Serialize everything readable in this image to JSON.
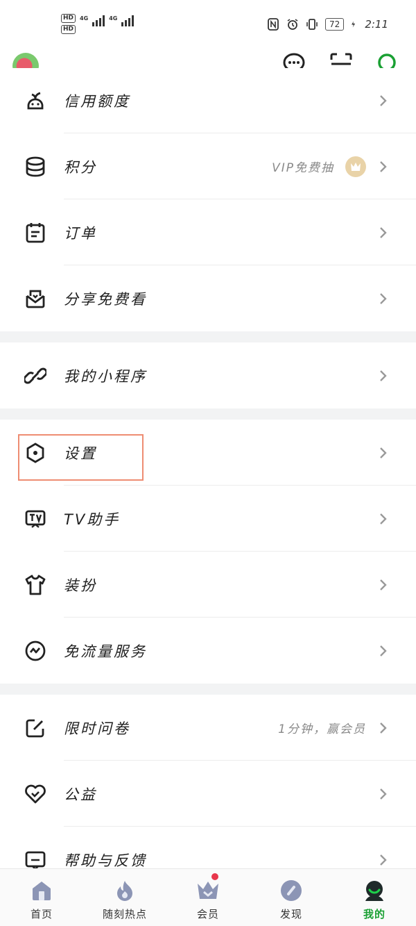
{
  "status_bar": {
    "hd1": "HD",
    "hd2": "HD",
    "net1": "4G",
    "net2": "4G",
    "battery": "72",
    "time": "2:11"
  },
  "menu_groups": [
    {
      "items": [
        {
          "label": "信用额度",
          "sub": "",
          "icon": "credit-icon"
        },
        {
          "label": "积分",
          "sub": "VIP免费抽",
          "icon": "points-coins-icon",
          "badge_icon": "vip-crown-icon"
        },
        {
          "label": "订单",
          "sub": "",
          "icon": "order-icon"
        },
        {
          "label": "分享免费看",
          "sub": "",
          "icon": "share-gift-icon"
        }
      ]
    },
    {
      "items": [
        {
          "label": "我的小程序",
          "sub": "",
          "icon": "mini-program-icon"
        }
      ]
    },
    {
      "items": [
        {
          "label": "设置",
          "sub": "",
          "icon": "settings-hexagon-icon"
        },
        {
          "label": "TV助手",
          "sub": "",
          "icon": "tv-icon"
        },
        {
          "label": "装扮",
          "sub": "",
          "icon": "tshirt-icon"
        },
        {
          "label": "免流量服务",
          "sub": "",
          "icon": "data-wave-icon"
        }
      ]
    },
    {
      "items": [
        {
          "label": "限时问卷",
          "sub": "1分钟，赢会员",
          "icon": "survey-edit-icon"
        },
        {
          "label": "公益",
          "sub": "",
          "icon": "charity-heart-icon"
        },
        {
          "label": "帮助与反馈",
          "sub": "",
          "icon": "help-feedback-icon"
        }
      ]
    }
  ],
  "tabs": [
    {
      "label": "首页",
      "icon": "home-icon"
    },
    {
      "label": "随刻热点",
      "icon": "hot-flame-icon"
    },
    {
      "label": "会员",
      "icon": "vip-crown-icon"
    },
    {
      "label": "发现",
      "icon": "discover-icon"
    },
    {
      "label": "我的",
      "icon": "profile-icon"
    }
  ],
  "colors": {
    "accent": "#1aa033",
    "highlight_box": "#ee8c72",
    "badge_dot": "#e8374c",
    "vip_gold": "#e9d3a8"
  }
}
